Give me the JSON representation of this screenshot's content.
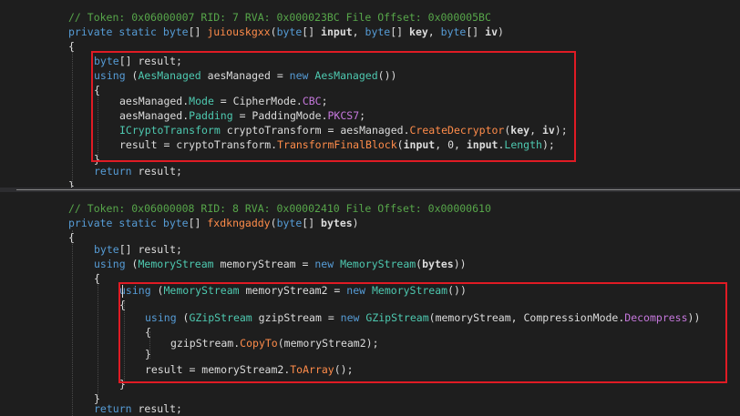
{
  "editor": {
    "top_lines": [
      [
        {
          "s": "c",
          "t": "// Token: 0x06000007 RID: 7 RVA: 0x000023BC File Offset: 0x000005BC"
        }
      ],
      [
        {
          "s": "k",
          "t": "private"
        },
        {
          "s": "",
          "t": " "
        },
        {
          "s": "k",
          "t": "static"
        },
        {
          "s": "",
          "t": " "
        },
        {
          "s": "k",
          "t": "byte"
        },
        {
          "s": "",
          "t": "[] "
        },
        {
          "s": "m",
          "t": "juiouskgxx"
        },
        {
          "s": "",
          "t": "("
        },
        {
          "s": "k",
          "t": "byte"
        },
        {
          "s": "",
          "t": "[] "
        },
        {
          "s": "p",
          "t": "input"
        },
        {
          "s": "",
          "t": ", "
        },
        {
          "s": "k",
          "t": "byte"
        },
        {
          "s": "",
          "t": "[] "
        },
        {
          "s": "p",
          "t": "key"
        },
        {
          "s": "",
          "t": ", "
        },
        {
          "s": "k",
          "t": "byte"
        },
        {
          "s": "",
          "t": "[] "
        },
        {
          "s": "p",
          "t": "iv"
        },
        {
          "s": "",
          "t": ")"
        }
      ],
      [
        {
          "s": "",
          "t": "{"
        }
      ],
      [
        {
          "s": "k",
          "t": "byte"
        },
        {
          "s": "",
          "t": "[] result;"
        }
      ],
      [
        {
          "s": "k",
          "t": "using"
        },
        {
          "s": "",
          "t": " ("
        },
        {
          "s": "t",
          "t": "AesManaged"
        },
        {
          "s": "",
          "t": " aesManaged = "
        },
        {
          "s": "k",
          "t": "new"
        },
        {
          "s": "",
          "t": " "
        },
        {
          "s": "t",
          "t": "AesManaged"
        },
        {
          "s": "",
          "t": "())"
        }
      ],
      [
        {
          "s": "",
          "t": "{"
        }
      ],
      [
        {
          "s": "",
          "t": "aesManaged."
        },
        {
          "s": "t",
          "t": "Mode"
        },
        {
          "s": "",
          "t": " = CipherMode."
        },
        {
          "s": "e",
          "t": "CBC"
        },
        {
          "s": "",
          "t": ";"
        }
      ],
      [
        {
          "s": "",
          "t": "aesManaged."
        },
        {
          "s": "t",
          "t": "Padding"
        },
        {
          "s": "",
          "t": " = PaddingMode."
        },
        {
          "s": "e",
          "t": "PKCS7"
        },
        {
          "s": "",
          "t": ";"
        }
      ],
      [
        {
          "s": "t",
          "t": "ICryptoTransform"
        },
        {
          "s": "",
          "t": " cryptoTransform = aesManaged."
        },
        {
          "s": "m",
          "t": "CreateDecryptor"
        },
        {
          "s": "",
          "t": "("
        },
        {
          "s": "p",
          "t": "key"
        },
        {
          "s": "",
          "t": ", "
        },
        {
          "s": "p",
          "t": "iv"
        },
        {
          "s": "",
          "t": ");"
        }
      ],
      [
        {
          "s": "",
          "t": "result = cryptoTransform."
        },
        {
          "s": "m",
          "t": "TransformFinalBlock"
        },
        {
          "s": "",
          "t": "("
        },
        {
          "s": "p",
          "t": "input"
        },
        {
          "s": "",
          "t": ", 0, "
        },
        {
          "s": "p",
          "t": "input"
        },
        {
          "s": "",
          "t": "."
        },
        {
          "s": "t",
          "t": "Length"
        },
        {
          "s": "",
          "t": ");"
        }
      ],
      [
        {
          "s": "",
          "t": "}"
        }
      ],
      [
        {
          "s": "k",
          "t": "return"
        },
        {
          "s": "",
          "t": " result;"
        }
      ],
      [
        {
          "s": "",
          "t": "}"
        }
      ]
    ],
    "bottom_lines": [
      [
        {
          "s": "c",
          "t": "// Token: 0x06000008 RID: 8 RVA: 0x00002410 File Offset: 0x00000610"
        }
      ],
      [
        {
          "s": "k",
          "t": "private"
        },
        {
          "s": "",
          "t": " "
        },
        {
          "s": "k",
          "t": "static"
        },
        {
          "s": "",
          "t": " "
        },
        {
          "s": "k",
          "t": "byte"
        },
        {
          "s": "",
          "t": "[] "
        },
        {
          "s": "m",
          "t": "fxdkngaddy"
        },
        {
          "s": "",
          "t": "("
        },
        {
          "s": "k",
          "t": "byte"
        },
        {
          "s": "",
          "t": "[] "
        },
        {
          "s": "p",
          "t": "bytes"
        },
        {
          "s": "",
          "t": ")"
        }
      ],
      [
        {
          "s": "",
          "t": "{"
        }
      ],
      [
        {
          "s": "k",
          "t": "byte"
        },
        {
          "s": "",
          "t": "[] result;"
        }
      ],
      [
        {
          "s": "k",
          "t": "using"
        },
        {
          "s": "",
          "t": " ("
        },
        {
          "s": "t",
          "t": "MemoryStream"
        },
        {
          "s": "",
          "t": " memoryStream = "
        },
        {
          "s": "k",
          "t": "new"
        },
        {
          "s": "",
          "t": " "
        },
        {
          "s": "t",
          "t": "MemoryStream"
        },
        {
          "s": "",
          "t": "("
        },
        {
          "s": "p",
          "t": "bytes"
        },
        {
          "s": "",
          "t": "))"
        }
      ],
      [
        {
          "s": "",
          "t": "{"
        }
      ],
      [
        {
          "s": "k",
          "t": "using"
        },
        {
          "s": "",
          "t": " ("
        },
        {
          "s": "t",
          "t": "MemoryStream"
        },
        {
          "s": "",
          "t": " memoryStream2 = "
        },
        {
          "s": "k",
          "t": "new"
        },
        {
          "s": "",
          "t": " "
        },
        {
          "s": "t",
          "t": "MemoryStream"
        },
        {
          "s": "",
          "t": "())"
        }
      ],
      [
        {
          "s": "",
          "t": "{"
        }
      ],
      [
        {
          "s": "k",
          "t": "using"
        },
        {
          "s": "",
          "t": " ("
        },
        {
          "s": "t",
          "t": "GZipStream"
        },
        {
          "s": "",
          "t": " gzipStream = "
        },
        {
          "s": "k",
          "t": "new"
        },
        {
          "s": "",
          "t": " "
        },
        {
          "s": "t",
          "t": "GZipStream"
        },
        {
          "s": "",
          "t": "(memoryStream, CompressionMode."
        },
        {
          "s": "e",
          "t": "Decompress"
        },
        {
          "s": "",
          "t": "))"
        }
      ],
      [
        {
          "s": "",
          "t": "{"
        }
      ],
      [
        {
          "s": "",
          "t": "gzipStream."
        },
        {
          "s": "m",
          "t": "CopyTo"
        },
        {
          "s": "",
          "t": "(memoryStream2);"
        }
      ],
      [
        {
          "s": "",
          "t": "}"
        }
      ],
      [
        {
          "s": "",
          "t": "result = memoryStream2."
        },
        {
          "s": "m",
          "t": "ToArray"
        },
        {
          "s": "",
          "t": "();"
        }
      ],
      [
        {
          "s": "",
          "t": "}"
        }
      ],
      [
        {
          "s": "",
          "t": "}"
        }
      ],
      [
        {
          "s": "k",
          "t": "return"
        },
        {
          "s": "",
          "t": " result;"
        }
      ]
    ]
  },
  "colors": {
    "background": "#1e1e1e",
    "highlight_box": "#e01b24",
    "keyword": "#569cd6",
    "type": "#4ec9b0",
    "comment": "#57a64a",
    "method": "#ff8c4a",
    "enum_member": "#c678dd"
  }
}
